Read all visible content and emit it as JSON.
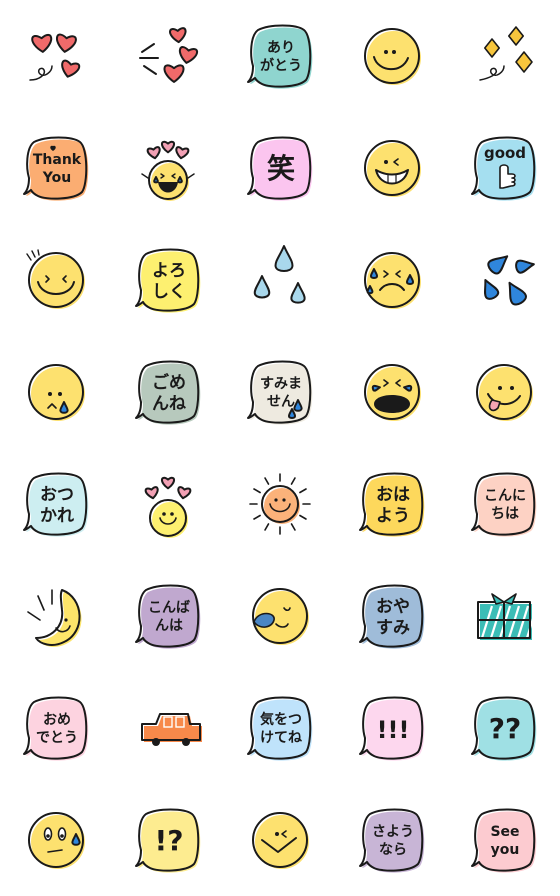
{
  "colors": {
    "outline": "#1a1a1a",
    "face_yellow": "#fde16f",
    "heart_red": "#f06a6a",
    "heart_pink": "#f2a0b4",
    "drop_light": "#a9d8ec",
    "drop_blue": "#2f86dc",
    "sparkle": "#f7c63d",
    "sun_orange": "#fbb27a",
    "car_orange": "#f7894a",
    "gift_teal": "#3bbdb6"
  },
  "stickers": [
    {
      "id": 1,
      "kind": "hearts",
      "name": "hearts-sticker",
      "lines": [],
      "fill": "#f06a6a"
    },
    {
      "id": 2,
      "kind": "hearts-burst",
      "name": "flying-hearts-sticker",
      "lines": [],
      "fill": "#f06a6a"
    },
    {
      "id": 3,
      "kind": "bubble",
      "name": "arigatou-bubble",
      "lines": [
        "あり",
        "がとう"
      ],
      "fill": "#8fd5cf"
    },
    {
      "id": 4,
      "kind": "face-smile",
      "name": "smile-face",
      "lines": [],
      "fill": "#fde16f"
    },
    {
      "id": 5,
      "kind": "sparkles",
      "name": "sparkles-sticker",
      "lines": [],
      "fill": "#f7c63d"
    },
    {
      "id": 6,
      "kind": "bubble",
      "name": "thank-you-bubble",
      "lines": [
        "Thank",
        "You"
      ],
      "fill": "#fbad72"
    },
    {
      "id": 7,
      "kind": "face-laugh",
      "name": "laughing-cheer-face",
      "lines": [],
      "fill": "#fde16f"
    },
    {
      "id": 8,
      "kind": "bubble",
      "name": "warai-bubble",
      "lines": [
        "笑"
      ],
      "fill": "#fbc5ef"
    },
    {
      "id": 9,
      "kind": "face-grin",
      "name": "grinning-wink-face",
      "lines": [],
      "fill": "#fde16f"
    },
    {
      "id": 10,
      "kind": "bubble-thumb",
      "name": "good-thumbs-up-bubble",
      "lines": [
        "good"
      ],
      "fill": "#a5dff0"
    },
    {
      "id": 11,
      "kind": "face-happy",
      "name": "happy-squint-face",
      "lines": [],
      "fill": "#fde16f"
    },
    {
      "id": 12,
      "kind": "bubble",
      "name": "yoroshiku-bubble",
      "lines": [
        "よろ",
        "しく"
      ],
      "fill": "#fdf070"
    },
    {
      "id": 13,
      "kind": "drops",
      "name": "sweat-drops-light",
      "lines": [],
      "fill": "#a9d8ec"
    },
    {
      "id": 14,
      "kind": "face-sad",
      "name": "sad-sweat-face",
      "lines": [],
      "fill": "#fde16f"
    },
    {
      "id": 15,
      "kind": "splash",
      "name": "blue-splash-drops",
      "lines": [],
      "fill": "#2f86dc"
    },
    {
      "id": 16,
      "kind": "face-tear",
      "name": "teary-face",
      "lines": [],
      "fill": "#fde16f"
    },
    {
      "id": 17,
      "kind": "bubble",
      "name": "gomenne-bubble",
      "lines": [
        "ごめ",
        "んね"
      ],
      "fill": "#b7c9bd"
    },
    {
      "id": 18,
      "kind": "bubble",
      "name": "sumimasen-bubble",
      "lines": [
        "すみま",
        "せん"
      ],
      "fill": "#eeeae0"
    },
    {
      "id": 19,
      "kind": "face-cry",
      "name": "crying-face",
      "lines": [],
      "fill": "#fde16f"
    },
    {
      "id": 20,
      "kind": "face-tongue",
      "name": "tongue-out-face",
      "lines": [],
      "fill": "#fde16f"
    },
    {
      "id": 21,
      "kind": "bubble",
      "name": "otsukare-bubble",
      "lines": [
        "おつ",
        "かれ"
      ],
      "fill": "#cdeef1"
    },
    {
      "id": 22,
      "kind": "face-love",
      "name": "love-hearts-face",
      "lines": [],
      "fill": "#fdf070"
    },
    {
      "id": 23,
      "kind": "sun",
      "name": "smiling-sun",
      "lines": [],
      "fill": "#fbb27a"
    },
    {
      "id": 24,
      "kind": "bubble",
      "name": "ohayou-bubble",
      "lines": [
        "おは",
        "よう"
      ],
      "fill": "#fdd85c"
    },
    {
      "id": 25,
      "kind": "bubble",
      "name": "konnichiwa-bubble",
      "lines": [
        "こんに",
        "ちは"
      ],
      "fill": "#fdd2c4"
    },
    {
      "id": 26,
      "kind": "moon",
      "name": "crescent-moon",
      "lines": [],
      "fill": "#fde56a"
    },
    {
      "id": 27,
      "kind": "bubble",
      "name": "konbanwa-bubble",
      "lines": [
        "こんば",
        "んは"
      ],
      "fill": "#c0a8cf"
    },
    {
      "id": 28,
      "kind": "face-sleep",
      "name": "sleeping-face",
      "lines": [],
      "fill": "#fde16f"
    },
    {
      "id": 29,
      "kind": "bubble",
      "name": "oyasumi-bubble",
      "lines": [
        "おや",
        "すみ"
      ],
      "fill": "#9fbcd9"
    },
    {
      "id": 30,
      "kind": "gift",
      "name": "gift-box",
      "lines": [],
      "fill": "#3bbdb6"
    },
    {
      "id": 31,
      "kind": "bubble",
      "name": "omedetou-bubble",
      "lines": [
        "おめ",
        "でとう"
      ],
      "fill": "#fdd3e0"
    },
    {
      "id": 32,
      "kind": "car",
      "name": "orange-car",
      "lines": [],
      "fill": "#f7894a"
    },
    {
      "id": 33,
      "kind": "bubble",
      "name": "kiwotsuketene-bubble",
      "lines": [
        "気をつ",
        "けてね"
      ],
      "fill": "#bfe3fb"
    },
    {
      "id": 34,
      "kind": "bubble",
      "name": "exclamation-bubble",
      "lines": [
        "!!!"
      ],
      "fill": "#fdd7ee"
    },
    {
      "id": 35,
      "kind": "bubble",
      "name": "question-bubble",
      "lines": [
        "??"
      ],
      "fill": "#9fe0e4"
    },
    {
      "id": 36,
      "kind": "face-nervous",
      "name": "nervous-sweat-face",
      "lines": [],
      "fill": "#fde16f"
    },
    {
      "id": 37,
      "kind": "bubble",
      "name": "interrobang-bubble",
      "lines": [
        "!?"
      ],
      "fill": "#fdec90"
    },
    {
      "id": 38,
      "kind": "face-wink",
      "name": "wink-grin-face",
      "lines": [],
      "fill": "#fde16f"
    },
    {
      "id": 39,
      "kind": "bubble",
      "name": "sayounara-bubble",
      "lines": [
        "さよう",
        "なら"
      ],
      "fill": "#c8b5d6"
    },
    {
      "id": 40,
      "kind": "bubble",
      "name": "see-you-bubble",
      "lines": [
        "See",
        "you"
      ],
      "fill": "#fccbd0"
    }
  ]
}
